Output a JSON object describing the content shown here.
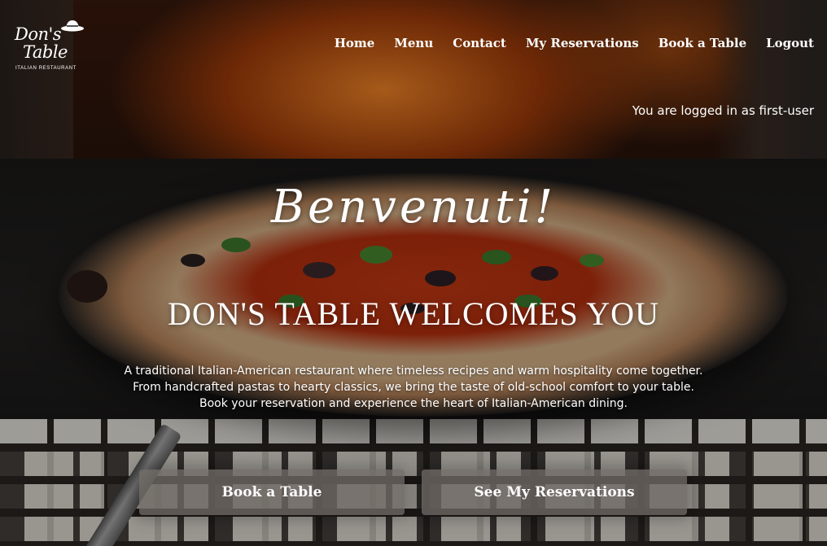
{
  "logo": {
    "line1": "Don's",
    "line2": "Table",
    "subtitle": "ITALIAN RESTAURANT"
  },
  "nav": {
    "items": [
      {
        "label": "Home"
      },
      {
        "label": "Menu"
      },
      {
        "label": "Contact"
      },
      {
        "label": "My Reservations"
      },
      {
        "label": "Book a Table"
      },
      {
        "label": "Logout"
      }
    ]
  },
  "login_status": "You are logged in as first-user",
  "hero": {
    "script_heading": "Benvenuti!",
    "title": "DON'S TABLE WELCOMES YOU",
    "description": [
      "A traditional Italian-American restaurant where timeless recipes and warm hospitality come together.",
      "From handcrafted pastas to hearty classics, we bring the taste of old-school comfort to your table.",
      "Book your reservation and experience the heart of Italian-American dining."
    ]
  },
  "buttons": {
    "book_label": "Book a Table",
    "reservations_label": "See My Reservations"
  },
  "colors": {
    "text": "#ffffff",
    "button_bg": "#6e6964"
  }
}
